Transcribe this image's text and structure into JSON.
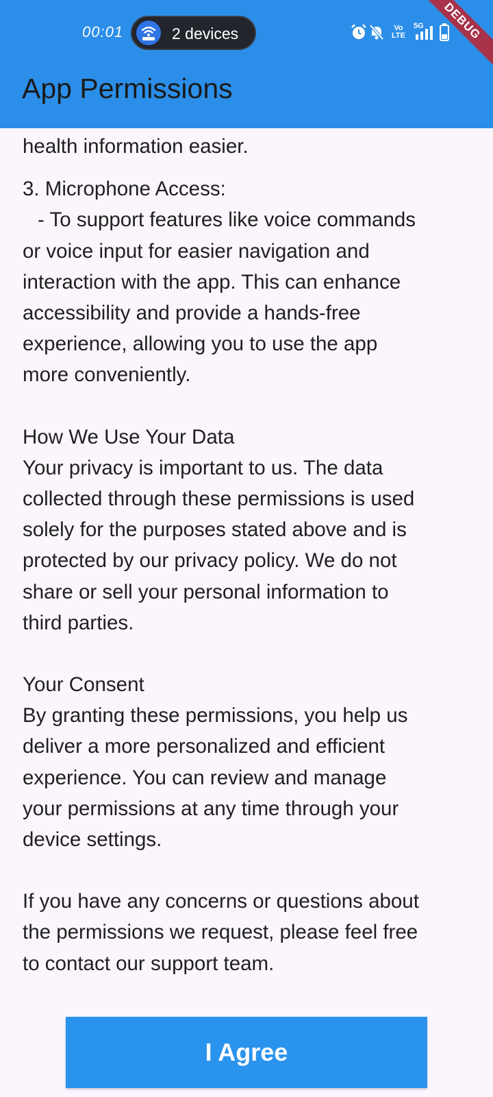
{
  "status_bar": {
    "time": "00:01",
    "connected_devices": "2 devices",
    "icons": [
      "hotspot-icon",
      "alarm-icon",
      "mute-icon",
      "volte-icon",
      "5g-signal-icon",
      "battery-icon"
    ],
    "network": "5G",
    "volte_text": "Vo LTE"
  },
  "debug_banner": "DEBUG",
  "app_bar": {
    "title": "App Permissions",
    "color": "#2b8ee8"
  },
  "content": {
    "partial_line_top": "health information easier.",
    "microphone_heading": "3. Microphone Access:",
    "microphone_lines": [
      "- To support features like voice commands",
      "or voice input for easier navigation and",
      "interaction with the app. This can enhance",
      "accessibility and provide a hands-free",
      "experience, allowing you to use the app",
      "more conveniently."
    ],
    "data_heading": "How We Use Your Data",
    "data_lines": [
      "Your privacy is important to us. The data",
      "collected through these permissions is used",
      "solely for the purposes stated above and is",
      "protected by our privacy policy. We do not",
      "share or sell your personal information to",
      "third parties."
    ],
    "consent_heading": "Your Consent",
    "consent_lines": [
      "By granting these permissions, you help us",
      "deliver a more personalized and efficient",
      "experience. You can review and manage",
      "your permissions at any time through your",
      "device settings."
    ],
    "contact_lines": [
      "If you have any concerns or questions about",
      "the permissions we request, please feel free",
      "to contact our support team."
    ]
  },
  "agree_button": {
    "label": "I Agree",
    "color": "#2a93ee"
  }
}
